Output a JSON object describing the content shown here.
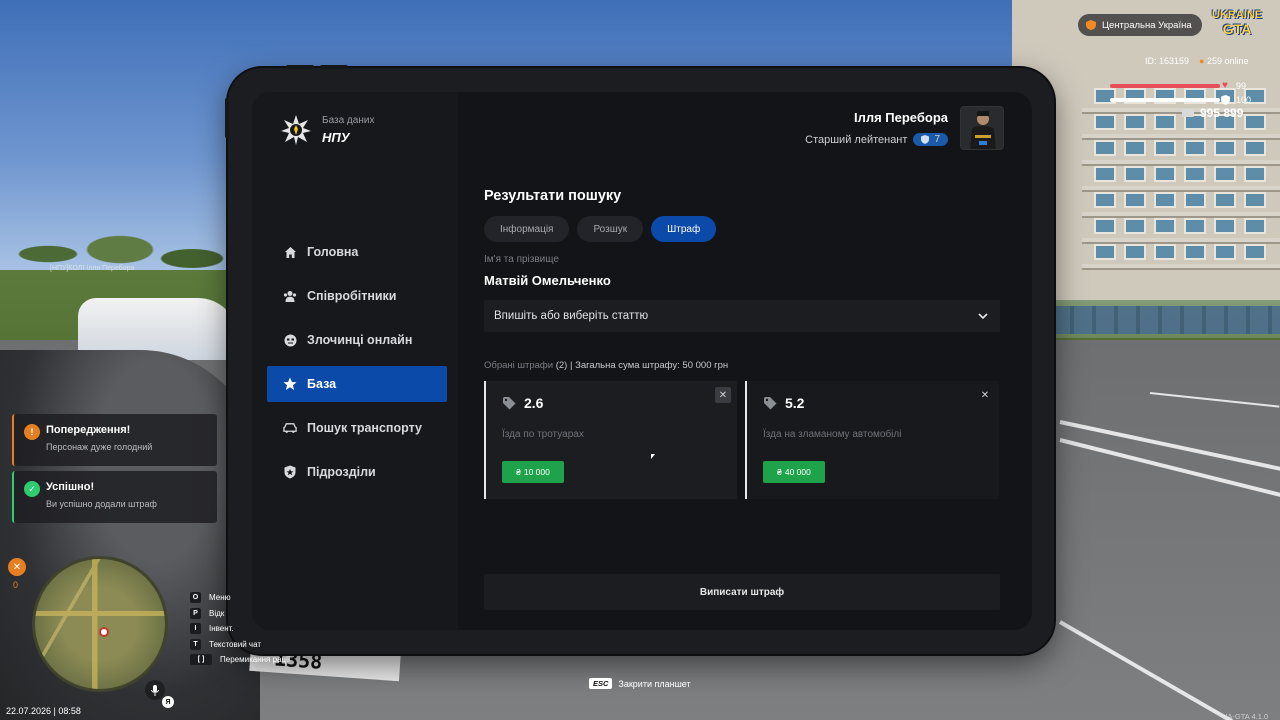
{
  "tablet": {
    "logo": {
      "sub": "База даних",
      "main": "НПУ"
    },
    "profile": {
      "name": "Ілля Перебора",
      "rank": "Старший лейтенант",
      "rank_level": "7"
    },
    "nav": [
      {
        "label": "Головна",
        "icon": "home-icon"
      },
      {
        "label": "Співробітники",
        "icon": "users-icon"
      },
      {
        "label": "Злочинці онлайн",
        "icon": "mask-icon"
      },
      {
        "label": "База",
        "icon": "star-icon",
        "active": true
      },
      {
        "label": "Пошук транспорту",
        "icon": "car-icon"
      },
      {
        "label": "Підрозділи",
        "icon": "shield-icon"
      }
    ],
    "content": {
      "title": "Результати пошуку",
      "tabs": [
        "Інформація",
        "Розшук",
        "Штраф"
      ],
      "active_tab": "Штраф",
      "name_label": "Ім'я та прізвище",
      "name_value": "Матвій Омельченко",
      "select_placeholder": "Впишіть або виберіть статтю",
      "summary_prefix": "Обрані штрафи",
      "summary_count": "(2)",
      "summary_total": "| Загальна сума штрафу: 50 000 грн",
      "fines": [
        {
          "code": "2.6",
          "description": "Їзда по тротуарах",
          "price": "10 000"
        },
        {
          "code": "5.2",
          "description": "Їзда на зламаному автомобілі",
          "price": "40 000"
        }
      ],
      "submit_label": "Виписати штраф"
    }
  },
  "hud": {
    "region": "Центральна Україна",
    "game_logo": [
      "UKRAINE",
      "GTA"
    ],
    "player_id": "ID: 163159",
    "online": "259 online",
    "health": "99",
    "armor": "100",
    "money": "995 899",
    "notifications": [
      {
        "title": "Попередження!",
        "text": "Персонаж дуже голодний",
        "type": "warning"
      },
      {
        "title": "Успішно!",
        "text": "Ви успішно додали штраф",
        "type": "success"
      }
    ],
    "keys": [
      {
        "key": "O",
        "label": "Меню"
      },
      {
        "key": "P",
        "label": "Відк"
      },
      {
        "key": "I",
        "label": "Інвент."
      },
      {
        "key": "T",
        "label": "Текстовий чат"
      },
      {
        "key": "[ ]",
        "label": "Перемикання рації"
      }
    ],
    "datetime": "22.07.2026 | 08:58",
    "hunger_value": "0",
    "voice_key": "Я",
    "esc_key": "ESC",
    "esc_hint": "Закрити планшет",
    "version": "UA-GTA 4.1.0",
    "plate": "1358",
    "ground_label": "[НПУ]КОЛІ Ілля Перебора"
  },
  "colors": {
    "accent": "#0b4aa8",
    "price": "#1fa34a",
    "health": "#e84d5b",
    "armor": "#ffffff"
  }
}
